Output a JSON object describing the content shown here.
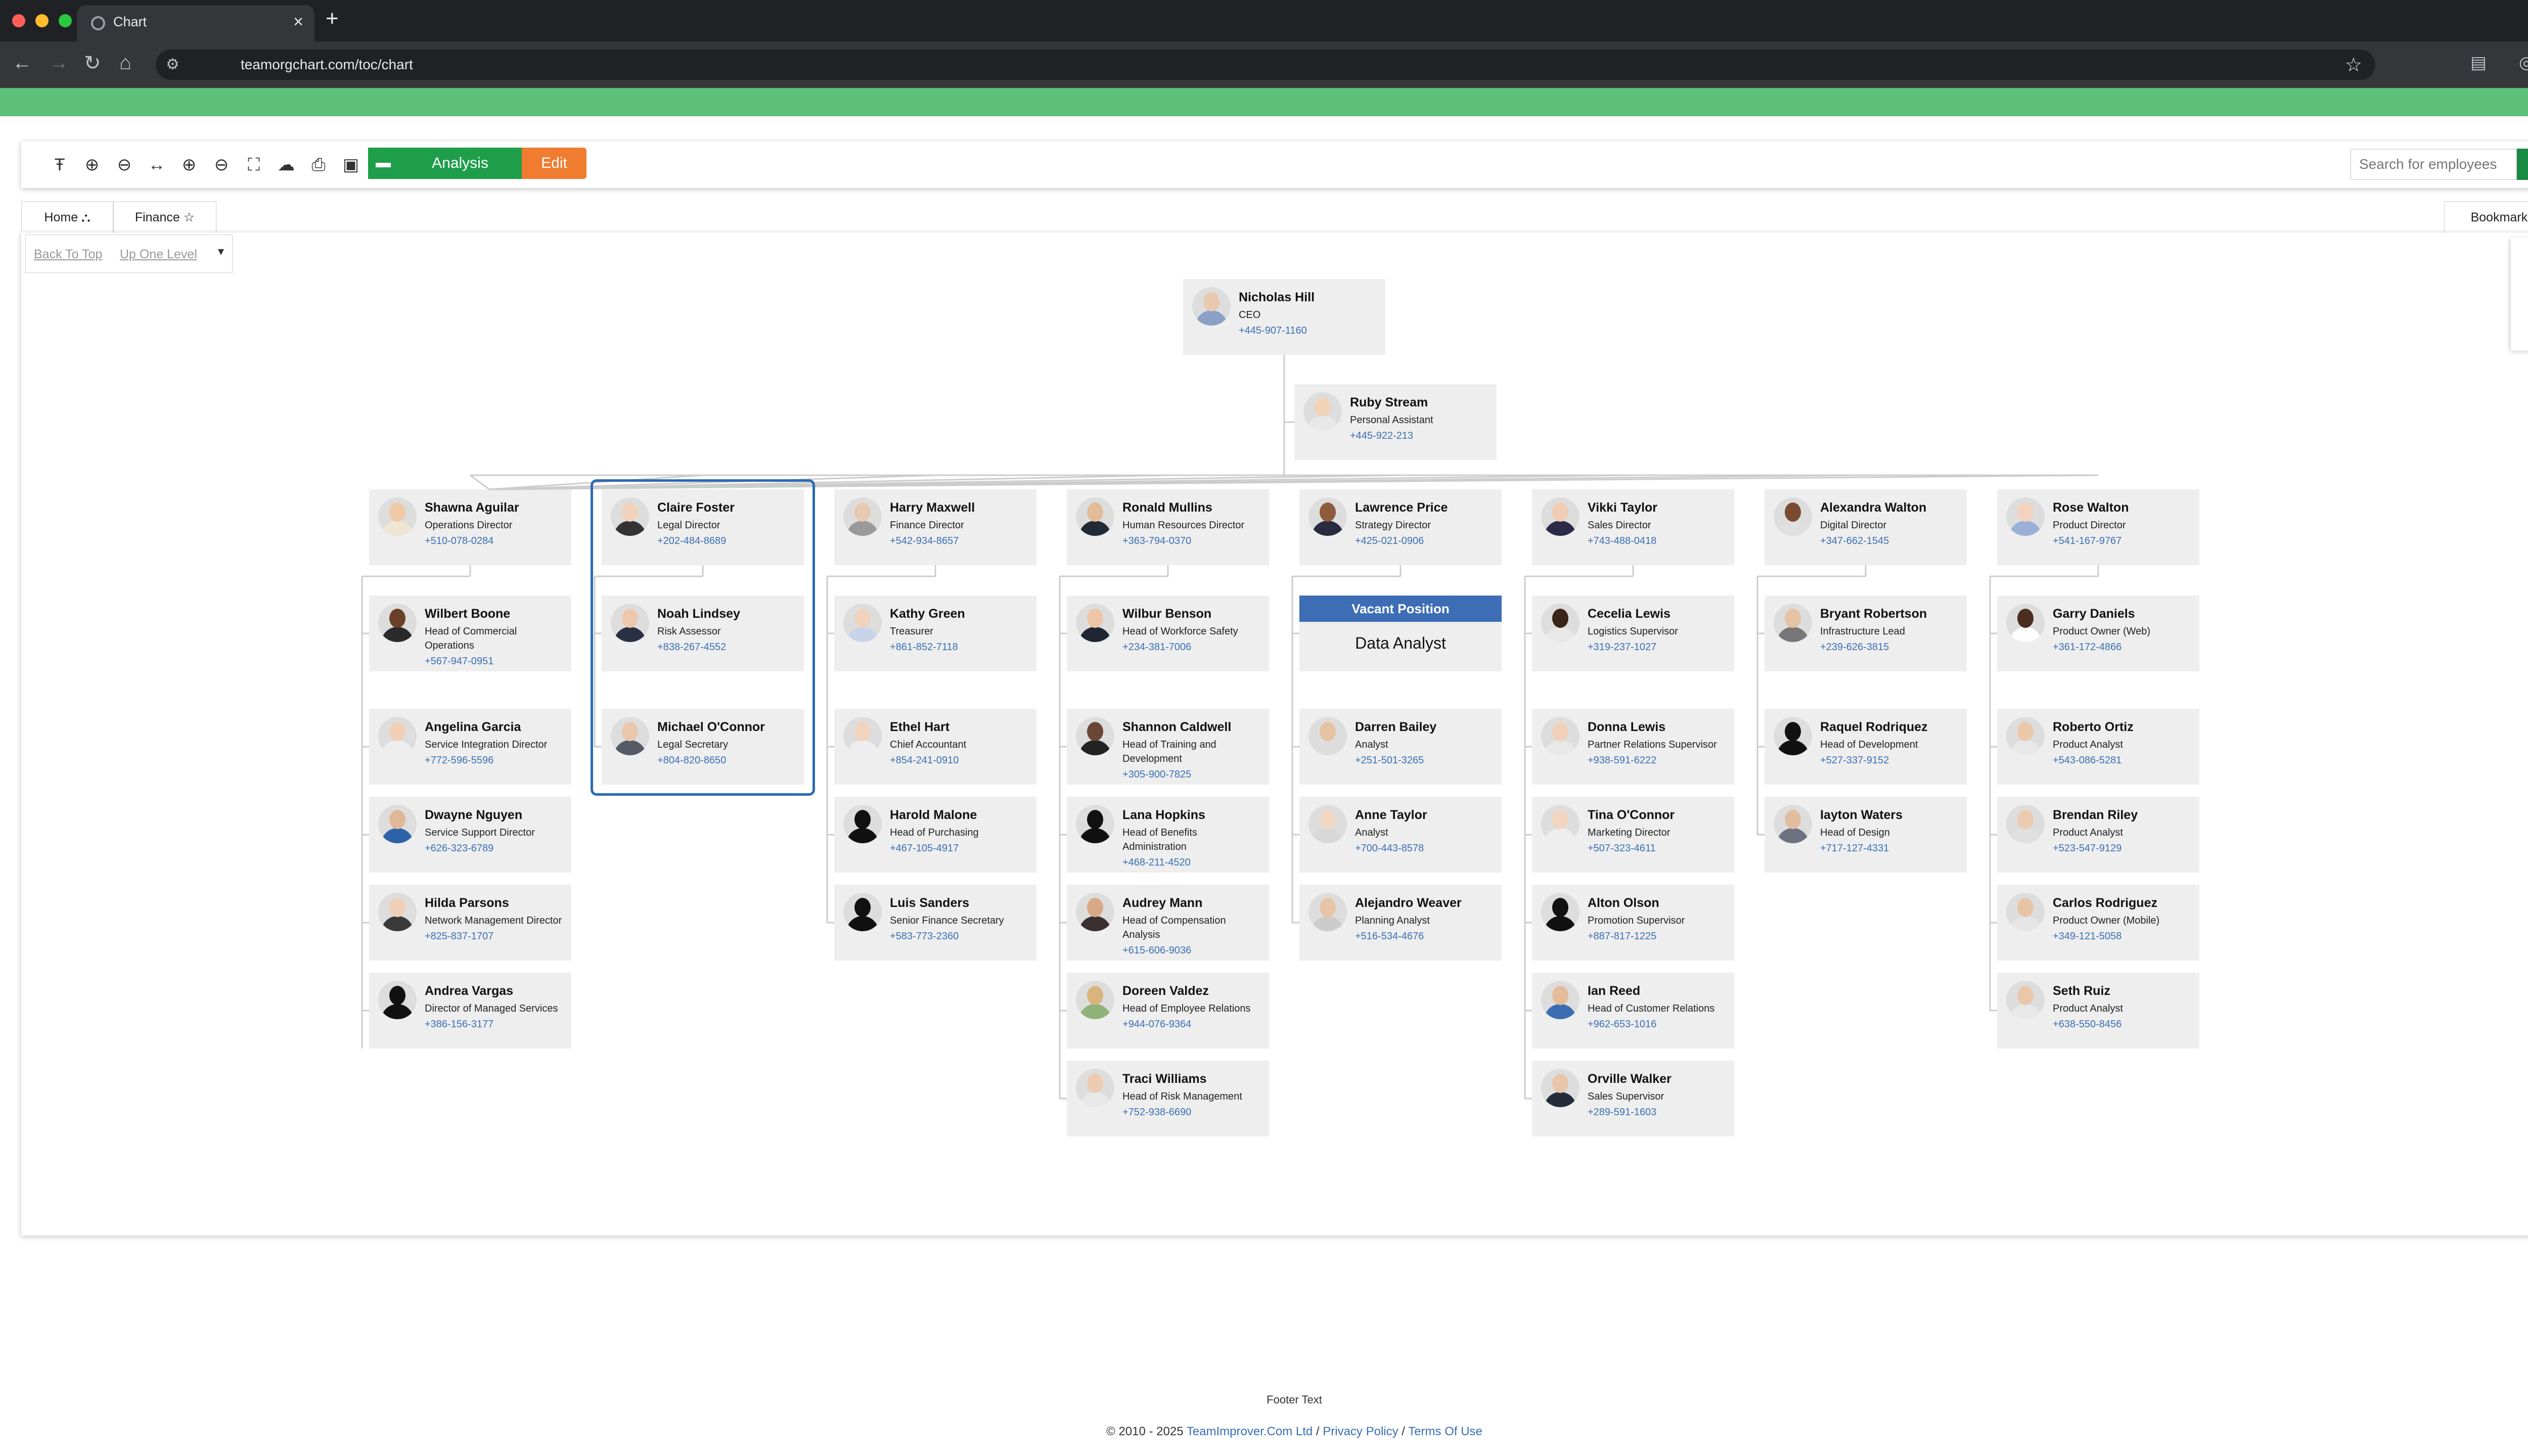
{
  "browser": {
    "tab_title": "Chart",
    "url": "teamorgchart.com/toc/chart"
  },
  "toolbar": {
    "analysis_label": "Analysis",
    "edit_label": "Edit",
    "search_placeholder": "Search for employees"
  },
  "tabs": {
    "home": "Home",
    "finance": "Finance",
    "bookmarks": "Bookmarks"
  },
  "breadcrumb": {
    "back_to_top": "Back To Top",
    "up_one_level": "Up One Level"
  },
  "vacant": {
    "header": "Vacant Position",
    "role": "Data Analyst"
  },
  "people": [
    {
      "name": "Nicholas Hill",
      "role": "CEO",
      "phone": "+445-907-1160",
      "skin": "#e9c9ad",
      "shirt": "#8aa0c4"
    },
    {
      "name": "Ruby Stream",
      "role": "Personal Assistant",
      "phone": "+445-922-213",
      "skin": "#f1d3ba",
      "shirt": "#e8e8e8"
    },
    {
      "name": "Shawna Aguilar",
      "role": "Operations Director",
      "phone": "+510-078-0284",
      "skin": "#f0caa5",
      "shirt": "#f0e4d2"
    },
    {
      "name": "Claire Foster",
      "role": "Legal Director",
      "phone": "+202-484-8689",
      "skin": "#f1d2bd",
      "shirt": "#333333"
    },
    {
      "name": "Harry Maxwell",
      "role": "Finance Director",
      "phone": "+542-934-8657",
      "skin": "#e8c8ae",
      "shirt": "#9a9a9a"
    },
    {
      "name": "Ronald Mullins",
      "role": "Human Resources Director",
      "phone": "+363-794-0370",
      "skin": "#e2bb98",
      "shirt": "#222a36"
    },
    {
      "name": "Lawrence Price",
      "role": "Strategy Director",
      "phone": "+425-021-0906",
      "skin": "#8e5c3c",
      "shirt": "#2a2a40"
    },
    {
      "name": "Vikki Taylor",
      "role": "Sales Director",
      "phone": "+743-488-0418",
      "skin": "#f0cdb4",
      "shirt": "#2b2b45"
    },
    {
      "name": "Alexandra Walton",
      "role": "Digital Director",
      "phone": "+347-662-1545",
      "skin": "#7a4b30",
      "shirt": "#e0e0e0"
    },
    {
      "name": "Rose Walton",
      "role": "Product Director",
      "phone": "+541-167-9767",
      "skin": "#f3d3bf",
      "shirt": "#9ab0d8"
    },
    {
      "name": "Wilbert Boone",
      "role": "Head of Commercial Operations",
      "phone": "+567-947-0951",
      "skin": "#6b4028",
      "shirt": "#2a2a2a"
    },
    {
      "name": "Angelina Garcia",
      "role": "Service Integration Director",
      "phone": "+772-596-5596",
      "skin": "#f1cfb7",
      "shirt": "#eeeeee"
    },
    {
      "name": "Dwayne Nguyen",
      "role": "Service Support Director",
      "phone": "+626-323-6789",
      "skin": "#e0b895",
      "shirt": "#2d62a8"
    },
    {
      "name": "Hilda Parsons",
      "role": "Network Management Director",
      "phone": "+825-837-1707",
      "skin": "#f0cfb8",
      "shirt": "#3a3a3a"
    },
    {
      "name": "Andrea Vargas",
      "role": "Director of Managed Services",
      "phone": "+386-156-3177",
      "skin": "#111111",
      "shirt": "#111111"
    },
    {
      "name": "Noah Lindsey",
      "role": "Risk Assessor",
      "phone": "+838-267-4552",
      "skin": "#ecc9ae",
      "shirt": "#2a3044"
    },
    {
      "name": "Michael O'Connor",
      "role": "Legal Secretary",
      "phone": "+804-820-8650",
      "skin": "#e9c7ac",
      "shirt": "#555a66"
    },
    {
      "name": "Kathy Green",
      "role": "Treasurer",
      "phone": "+861-852-7118",
      "skin": "#f0d2bd",
      "shirt": "#c8d4e8"
    },
    {
      "name": "Ethel Hart",
      "role": "Chief Accountant",
      "phone": "+854-241-0910",
      "skin": "#f2d3bd",
      "shirt": "#eeeeee"
    },
    {
      "name": "Harold Malone",
      "role": "Head of Purchasing",
      "phone": "+467-105-4917",
      "skin": "#111111",
      "shirt": "#111111"
    },
    {
      "name": "Luis Sanders",
      "role": "Senior Finance Secretary",
      "phone": "+583-773-2360",
      "skin": "#111111",
      "shirt": "#111111"
    },
    {
      "name": "Wilbur Benson",
      "role": "Head of Workforce Safety",
      "phone": "+234-381-7006",
      "skin": "#ecc6a6",
      "shirt": "#1f2633"
    },
    {
      "name": "Shannon Caldwell",
      "role": "Head of Training and Development",
      "phone": "+305-900-7825",
      "skin": "#6a4634",
      "shirt": "#222222"
    },
    {
      "name": "Lana Hopkins",
      "role": "Head of Benefits Administration",
      "phone": "+468-211-4520",
      "skin": "#111111",
      "shirt": "#111111"
    },
    {
      "name": "Audrey Mann",
      "role": "Head of Compensation Analysis",
      "phone": "+615-606-9036",
      "skin": "#d9a886",
      "shirt": "#3a3030"
    },
    {
      "name": "Doreen Valdez",
      "role": "Head of Employee Relations",
      "phone": "+944-076-9364",
      "skin": "#d9b47f",
      "shirt": "#8fb37a"
    },
    {
      "name": "Traci Williams",
      "role": "Head of Risk Management",
      "phone": "+752-938-6690",
      "skin": "#edcbb1",
      "shirt": "#e8e8e8"
    },
    {
      "name": "Darren Bailey",
      "role": "Analyst",
      "phone": "+251-501-3265",
      "skin": "#e6c2a2",
      "shirt": "#dddddd"
    },
    {
      "name": "Anne Taylor",
      "role": "Analyst",
      "phone": "+700-443-8578",
      "skin": "#f1d6c2",
      "shirt": "#d8d8d8"
    },
    {
      "name": "Alejandro Weaver",
      "role": "Planning Analyst",
      "phone": "+516-534-4676",
      "skin": "#e8c4a6",
      "shirt": "#cccccc"
    },
    {
      "name": "Cecelia Lewis",
      "role": "Logistics Supervisor",
      "phone": "+319-237-1027",
      "skin": "#3b2418",
      "shirt": "#e8e8e8"
    },
    {
      "name": "Donna Lewis",
      "role": "Partner Relations Supervisor",
      "phone": "+938-591-6222",
      "skin": "#f0d0bb",
      "shirt": "#e8e8e8"
    },
    {
      "name": "Tina O'Connor",
      "role": "Marketing Director",
      "phone": "+507-323-4611",
      "skin": "#f2d5c0",
      "shirt": "#eeeeee"
    },
    {
      "name": "Alton Olson",
      "role": "Promotion Supervisor",
      "phone": "+887-817-1225",
      "skin": "#111111",
      "shirt": "#111111"
    },
    {
      "name": "Ian Reed",
      "role": "Head of Customer Relations",
      "phone": "+962-653-1016",
      "skin": "#e3bc9c",
      "shirt": "#3b6db0"
    },
    {
      "name": "Orville Walker",
      "role": "Sales Supervisor",
      "phone": "+289-591-1603",
      "skin": "#e9c6aa",
      "shirt": "#262b3a"
    },
    {
      "name": "Bryant Robertson",
      "role": "Infrastructure Lead",
      "phone": "+239-626-3815",
      "skin": "#e6c3a5",
      "shirt": "#777777"
    },
    {
      "name": "Raquel Rodriquez",
      "role": "Head of Development",
      "phone": "+527-337-9152",
      "skin": "#111111",
      "shirt": "#111111"
    },
    {
      "name": "Iayton Waters",
      "role": "Head of Design",
      "phone": "+717-127-4331",
      "skin": "#e2bda0",
      "shirt": "#6c7280"
    },
    {
      "name": "Garry Daniels",
      "role": "Product Owner (Web)",
      "phone": "+361-172-4866",
      "skin": "#4a2e20",
      "shirt": "#ffffff"
    },
    {
      "name": "Roberto Ortiz",
      "role": "Product Analyst",
      "phone": "+543-086-5281",
      "skin": "#ecc8ab",
      "shirt": "#e8e8e8"
    },
    {
      "name": "Brendan Riley",
      "role": "Product Analyst",
      "phone": "+523-547-9129",
      "skin": "#edcbb0",
      "shirt": "#e0e0e0"
    },
    {
      "name": "Carlos Rodriguez",
      "role": "Product Owner (Mobile)",
      "phone": "+349-121-5058",
      "skin": "#e8c4a6",
      "shirt": "#e6e6e6"
    },
    {
      "name": "Seth Ruiz",
      "role": "Product Analyst",
      "phone": "+638-550-8456",
      "skin": "#ebc7aa",
      "shirt": "#e8e8e8"
    }
  ],
  "footer": {
    "text": "Footer Text",
    "copyright": "© 2010 - 2025",
    "company": "TeamImprover.Com Ltd",
    "sep1": "/",
    "privacy": "Privacy Policy",
    "sep2": "/",
    "terms": "Terms Of Use"
  },
  "colors": {
    "green_bar": "#5cbf7a",
    "analysis_green": "#1e9e4a",
    "edit_orange": "#ef7c2f",
    "selection_blue": "#2d6ab3",
    "vacant_blue": "#3d6db5",
    "phone_blue": "#3a6fb5"
  }
}
